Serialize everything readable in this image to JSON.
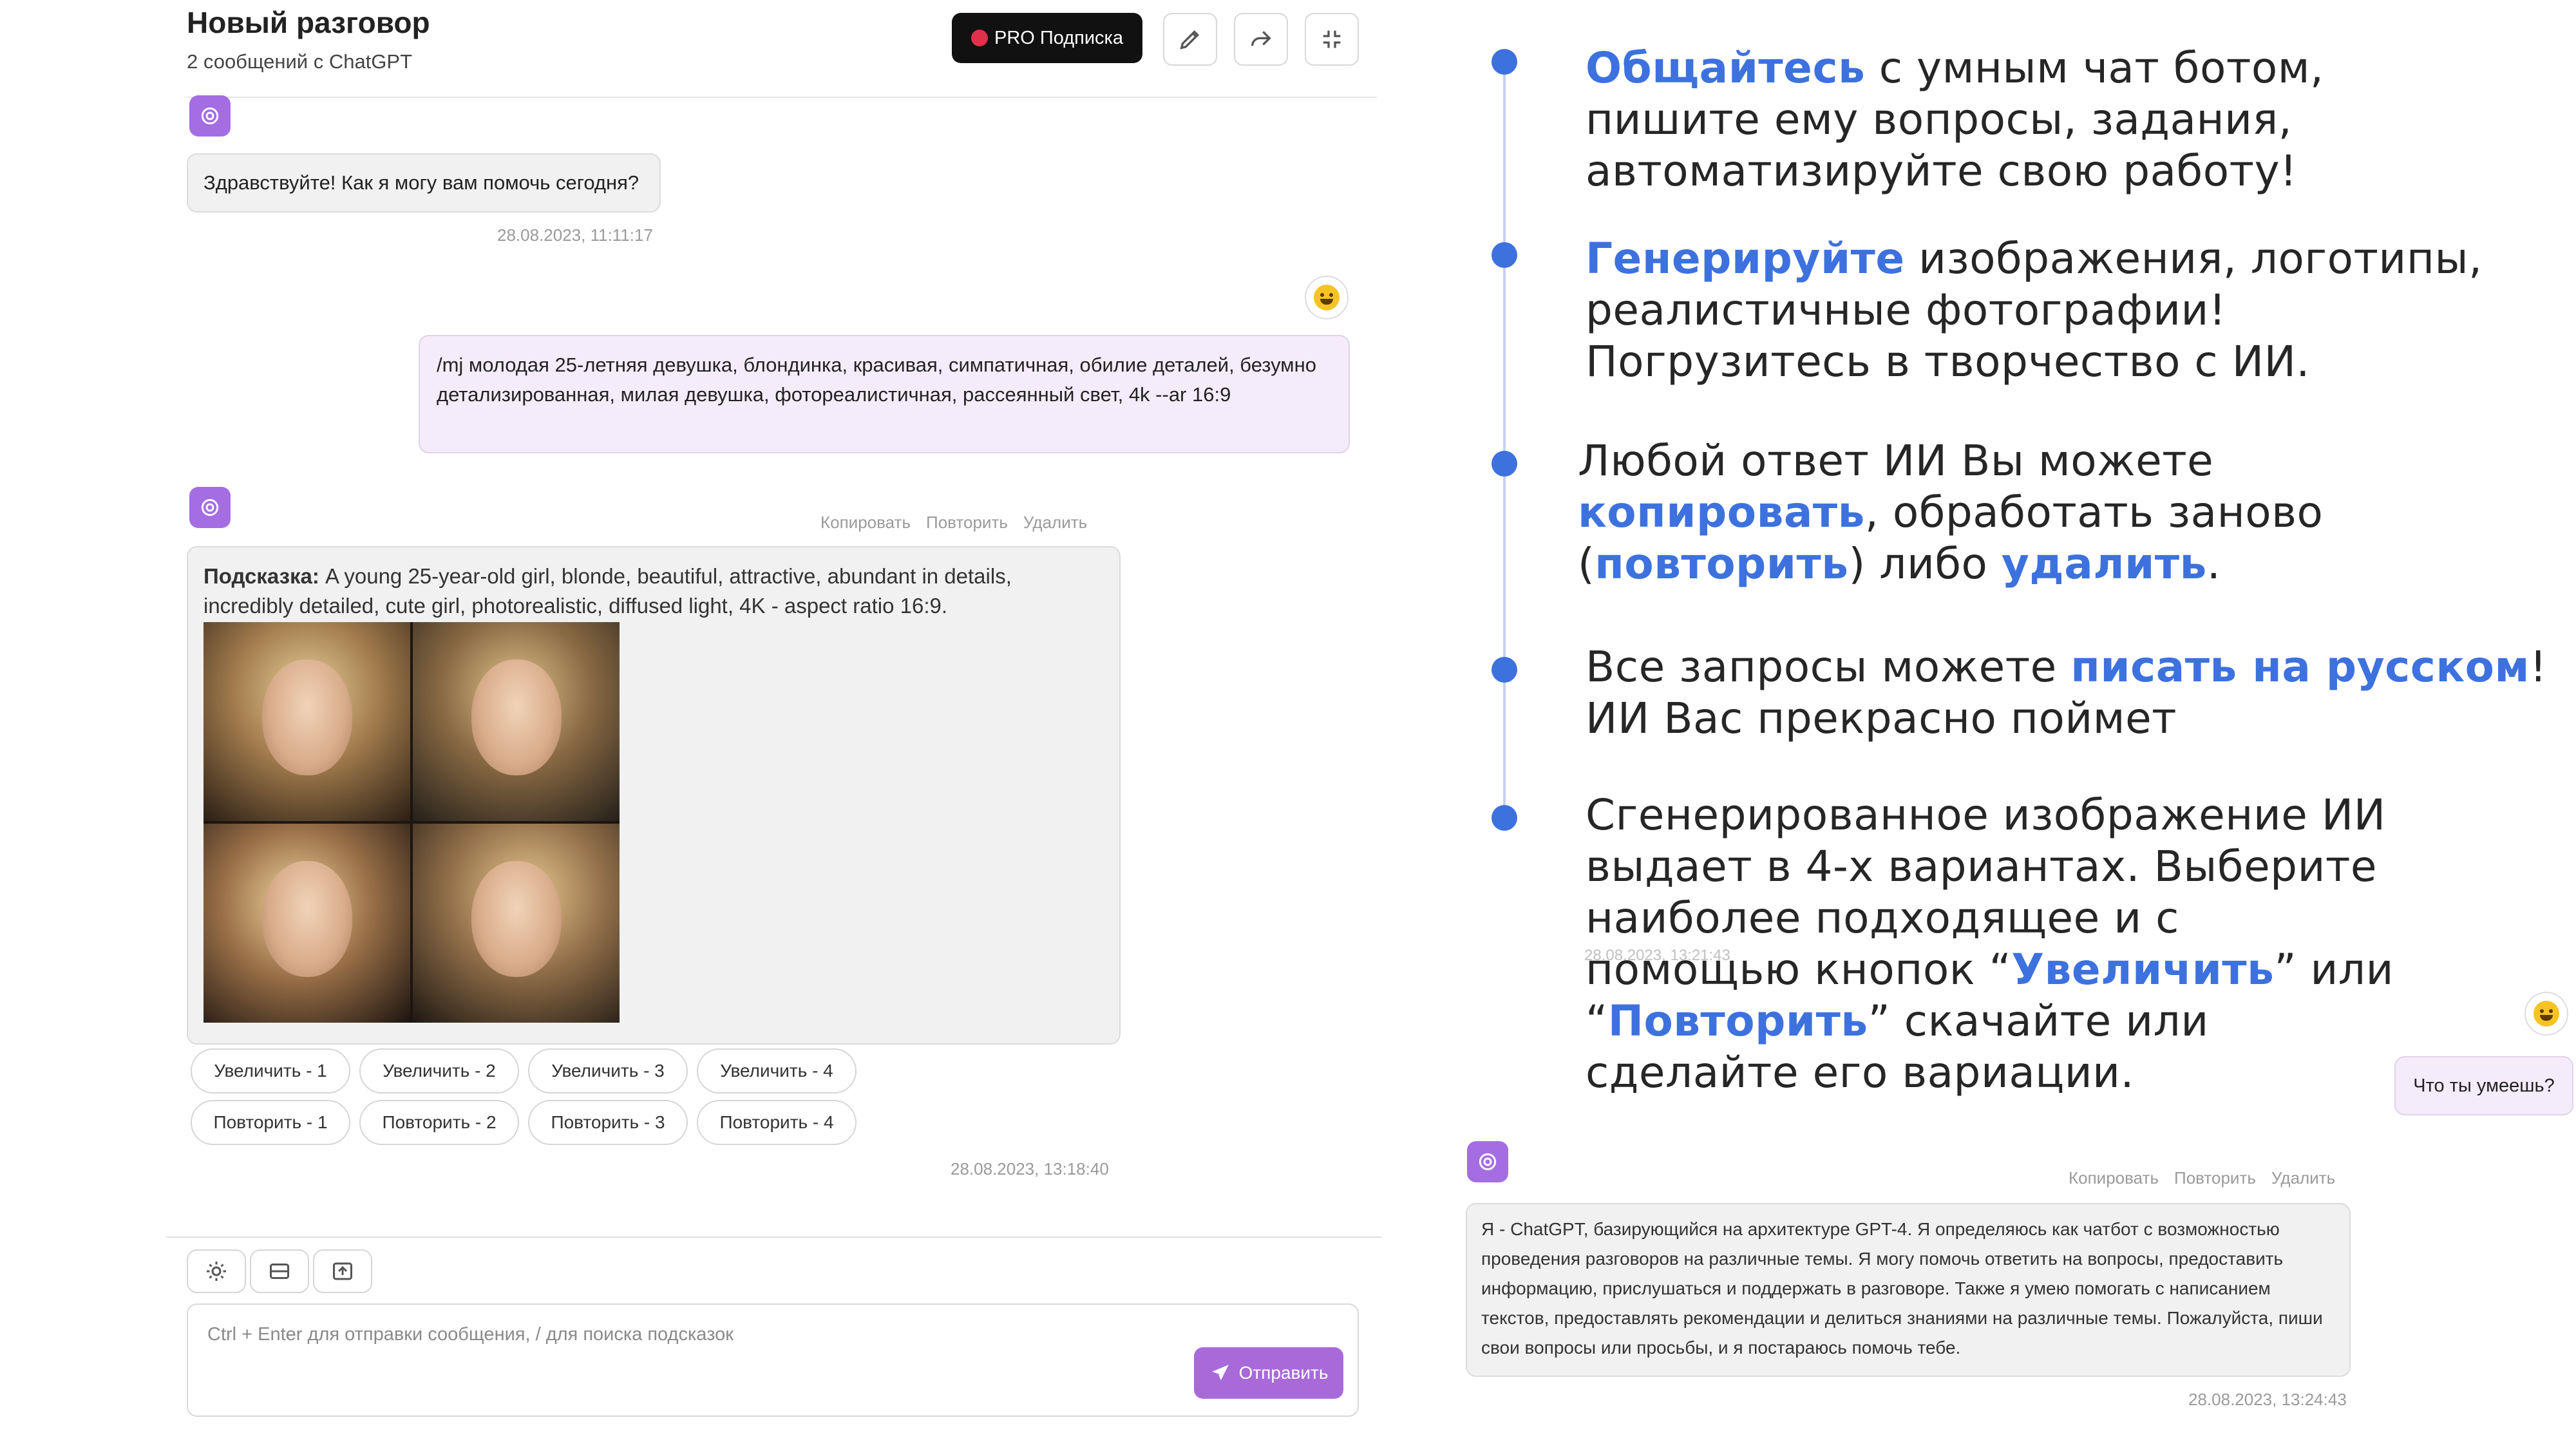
{
  "header": {
    "title": "Новый разговор",
    "subtitle": "2 сообщений с ChatGPT",
    "pro_label": "PRO Подписка",
    "icons": [
      "pencil-icon",
      "share-icon",
      "collapse-icon"
    ]
  },
  "messages": {
    "bot_greeting": {
      "text": "Здравствуйте! Как я могу вам помочь сегодня?",
      "time": "28.08.2023, 11:11:17"
    },
    "user_prompt": {
      "text": "/mj молодая 25-летняя девушка, блондинка, красивая, симпатичная, обилие деталей, безумно детализированная, милая девушка, фотореалистичная, рассеянный свет, 4k --ar 16:9"
    },
    "bot_image": {
      "hint_label": "Подсказка:",
      "hint_text": " A young 25-year-old girl, blonde, beautiful, attractive, abundant in details, incredibly detailed, cute girl, photorealistic, diffused light, 4K - aspect ratio 16:9.",
      "time": "28.08.2023, 13:18:40"
    }
  },
  "message_actions": {
    "copy": "Копировать",
    "repeat": "Повторить",
    "delete": "Удалить"
  },
  "upscale_buttons": [
    "Увеличить - 1",
    "Увеличить - 2",
    "Увеличить - 3",
    "Увеличить - 4"
  ],
  "repeat_buttons": [
    "Повторить - 1",
    "Повторить - 2",
    "Повторить - 3",
    "Повторить - 4"
  ],
  "composer": {
    "tool_icons": [
      "sun-icon",
      "image-icon",
      "upload-icon"
    ],
    "placeholder": "Ctrl + Enter для отправки сообщения, / для поиска подсказок",
    "send_label": "Отправить"
  },
  "features": {
    "f1": {
      "hl": "Общайтесь",
      "rest": " с умным чат ботом, пишите ему вопросы, задания, автоматизируйте свою работу!"
    },
    "f2": {
      "hl": "Генерируйте",
      "rest": " изображения, логотипы, реалистичные фотографии! Погрузитесь в творчество с ИИ."
    },
    "f3": {
      "t1": "Любой ответ ИИ Вы можете ",
      "hl1": "копировать",
      "t2": ", обработать заново (",
      "hl2": "повторить",
      "t3": ") либо ",
      "hl3": "удалить",
      "t4": "."
    },
    "f4": {
      "t1": "Все запросы можете ",
      "hl": "писать на русском",
      "t2": "! ИИ Вас прекрасно поймет"
    },
    "f5": {
      "t1": "Сгенерированное изображение ИИ выдает в 4-х вариантах. Выберите наиболее подходящее и с помощью кнопок “",
      "hl1": "Увеличить",
      "t2": "” или “",
      "hl2": "Повторить",
      "t3": "” скачайте или сделайте его вариации."
    }
  },
  "second_chat": {
    "ghost_time": "28.08.2023, 13:21:43",
    "user_text": "Что ты умеешь?",
    "bot_text": "Я - ChatGPT, базирующийся на архитектуре GPT-4. Я определяюсь как чатбот с возможностью проведения разговоров на различные темы. Я могу помочь ответить на вопросы, предоставить информацию, прислушаться и поддержать в разговоре. Также я умею помогать с написанием текстов, предоставлять рекомендации и делиться знаниями на различные темы. Пожалуйста, пиши свои вопросы или просьбы, и я постараюсь помочь тебе.",
    "time": "28.08.2023, 13:24:43"
  },
  "colors": {
    "accent_purple": "#a96ad9",
    "highlight_blue": "#3d71de"
  }
}
